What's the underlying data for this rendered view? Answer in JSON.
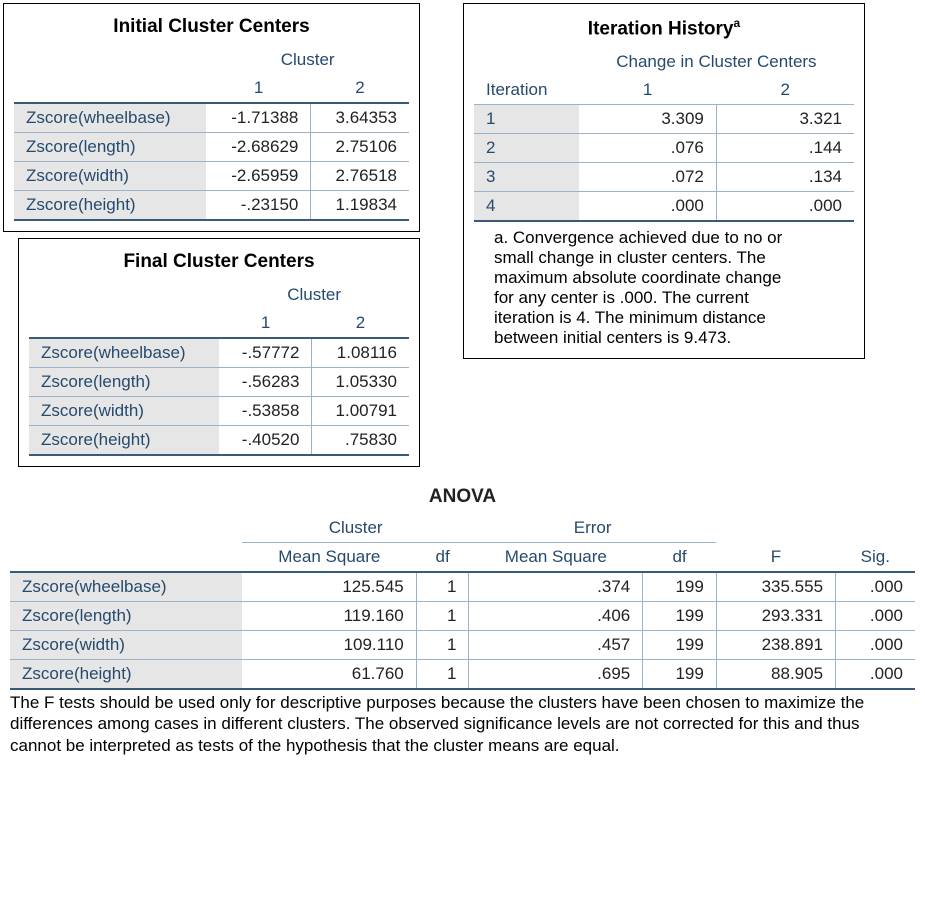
{
  "initial": {
    "title": "Initial Cluster Centers",
    "spanner": "Cluster",
    "cols": [
      "1",
      "2"
    ],
    "rows": [
      {
        "label": "Zscore(wheelbase)",
        "v1": "-1.71388",
        "v2": "3.64353"
      },
      {
        "label": "Zscore(length)",
        "v1": "-2.68629",
        "v2": "2.75106"
      },
      {
        "label": "Zscore(width)",
        "v1": "-2.65959",
        "v2": "2.76518"
      },
      {
        "label": "Zscore(height)",
        "v1": "-.23150",
        "v2": "1.19834"
      }
    ]
  },
  "final": {
    "title": "Final Cluster Centers",
    "spanner": "Cluster",
    "cols": [
      "1",
      "2"
    ],
    "rows": [
      {
        "label": "Zscore(wheelbase)",
        "v1": "-.57772",
        "v2": "1.08116"
      },
      {
        "label": "Zscore(length)",
        "v1": "-.56283",
        "v2": "1.05330"
      },
      {
        "label": "Zscore(width)",
        "v1": "-.53858",
        "v2": "1.00791"
      },
      {
        "label": "Zscore(height)",
        "v1": "-.40520",
        "v2": ".75830"
      }
    ]
  },
  "iter": {
    "title": "Iteration History",
    "sup": "a",
    "spanner": "Change in Cluster Centers",
    "iter_label": "Iteration",
    "cols": [
      "1",
      "2"
    ],
    "rows": [
      {
        "it": "1",
        "v1": "3.309",
        "v2": "3.321"
      },
      {
        "it": "2",
        "v1": ".076",
        "v2": ".144"
      },
      {
        "it": "3",
        "v1": ".072",
        "v2": ".134"
      },
      {
        "it": "4",
        "v1": ".000",
        "v2": ".000"
      }
    ],
    "footnote": "a. Convergence achieved due to no or small change in cluster centers. The maximum absolute coordinate change for any center is .000. The current iteration is 4. The minimum distance between initial centers is 9.473."
  },
  "anova": {
    "title": "ANOVA",
    "span_cluster": "Cluster",
    "span_error": "Error",
    "cols": {
      "ms": "Mean Square",
      "df": "df",
      "F": "F",
      "sig": "Sig."
    },
    "rows": [
      {
        "label": "Zscore(wheelbase)",
        "cms": "125.545",
        "cdf": "1",
        "ems": ".374",
        "edf": "199",
        "F": "335.555",
        "sig": ".000"
      },
      {
        "label": "Zscore(length)",
        "cms": "119.160",
        "cdf": "1",
        "ems": ".406",
        "edf": "199",
        "F": "293.331",
        "sig": ".000"
      },
      {
        "label": "Zscore(width)",
        "cms": "109.110",
        "cdf": "1",
        "ems": ".457",
        "edf": "199",
        "F": "238.891",
        "sig": ".000"
      },
      {
        "label": "Zscore(height)",
        "cms": "61.760",
        "cdf": "1",
        "ems": ".695",
        "edf": "199",
        "F": "88.905",
        "sig": ".000"
      }
    ],
    "footnote": "The F tests should be used only for descriptive purposes because the clusters have been chosen to maximize the differences among cases in different clusters. The observed significance levels are not corrected for this and thus cannot be interpreted as tests of the hypothesis that the cluster means are equal."
  }
}
